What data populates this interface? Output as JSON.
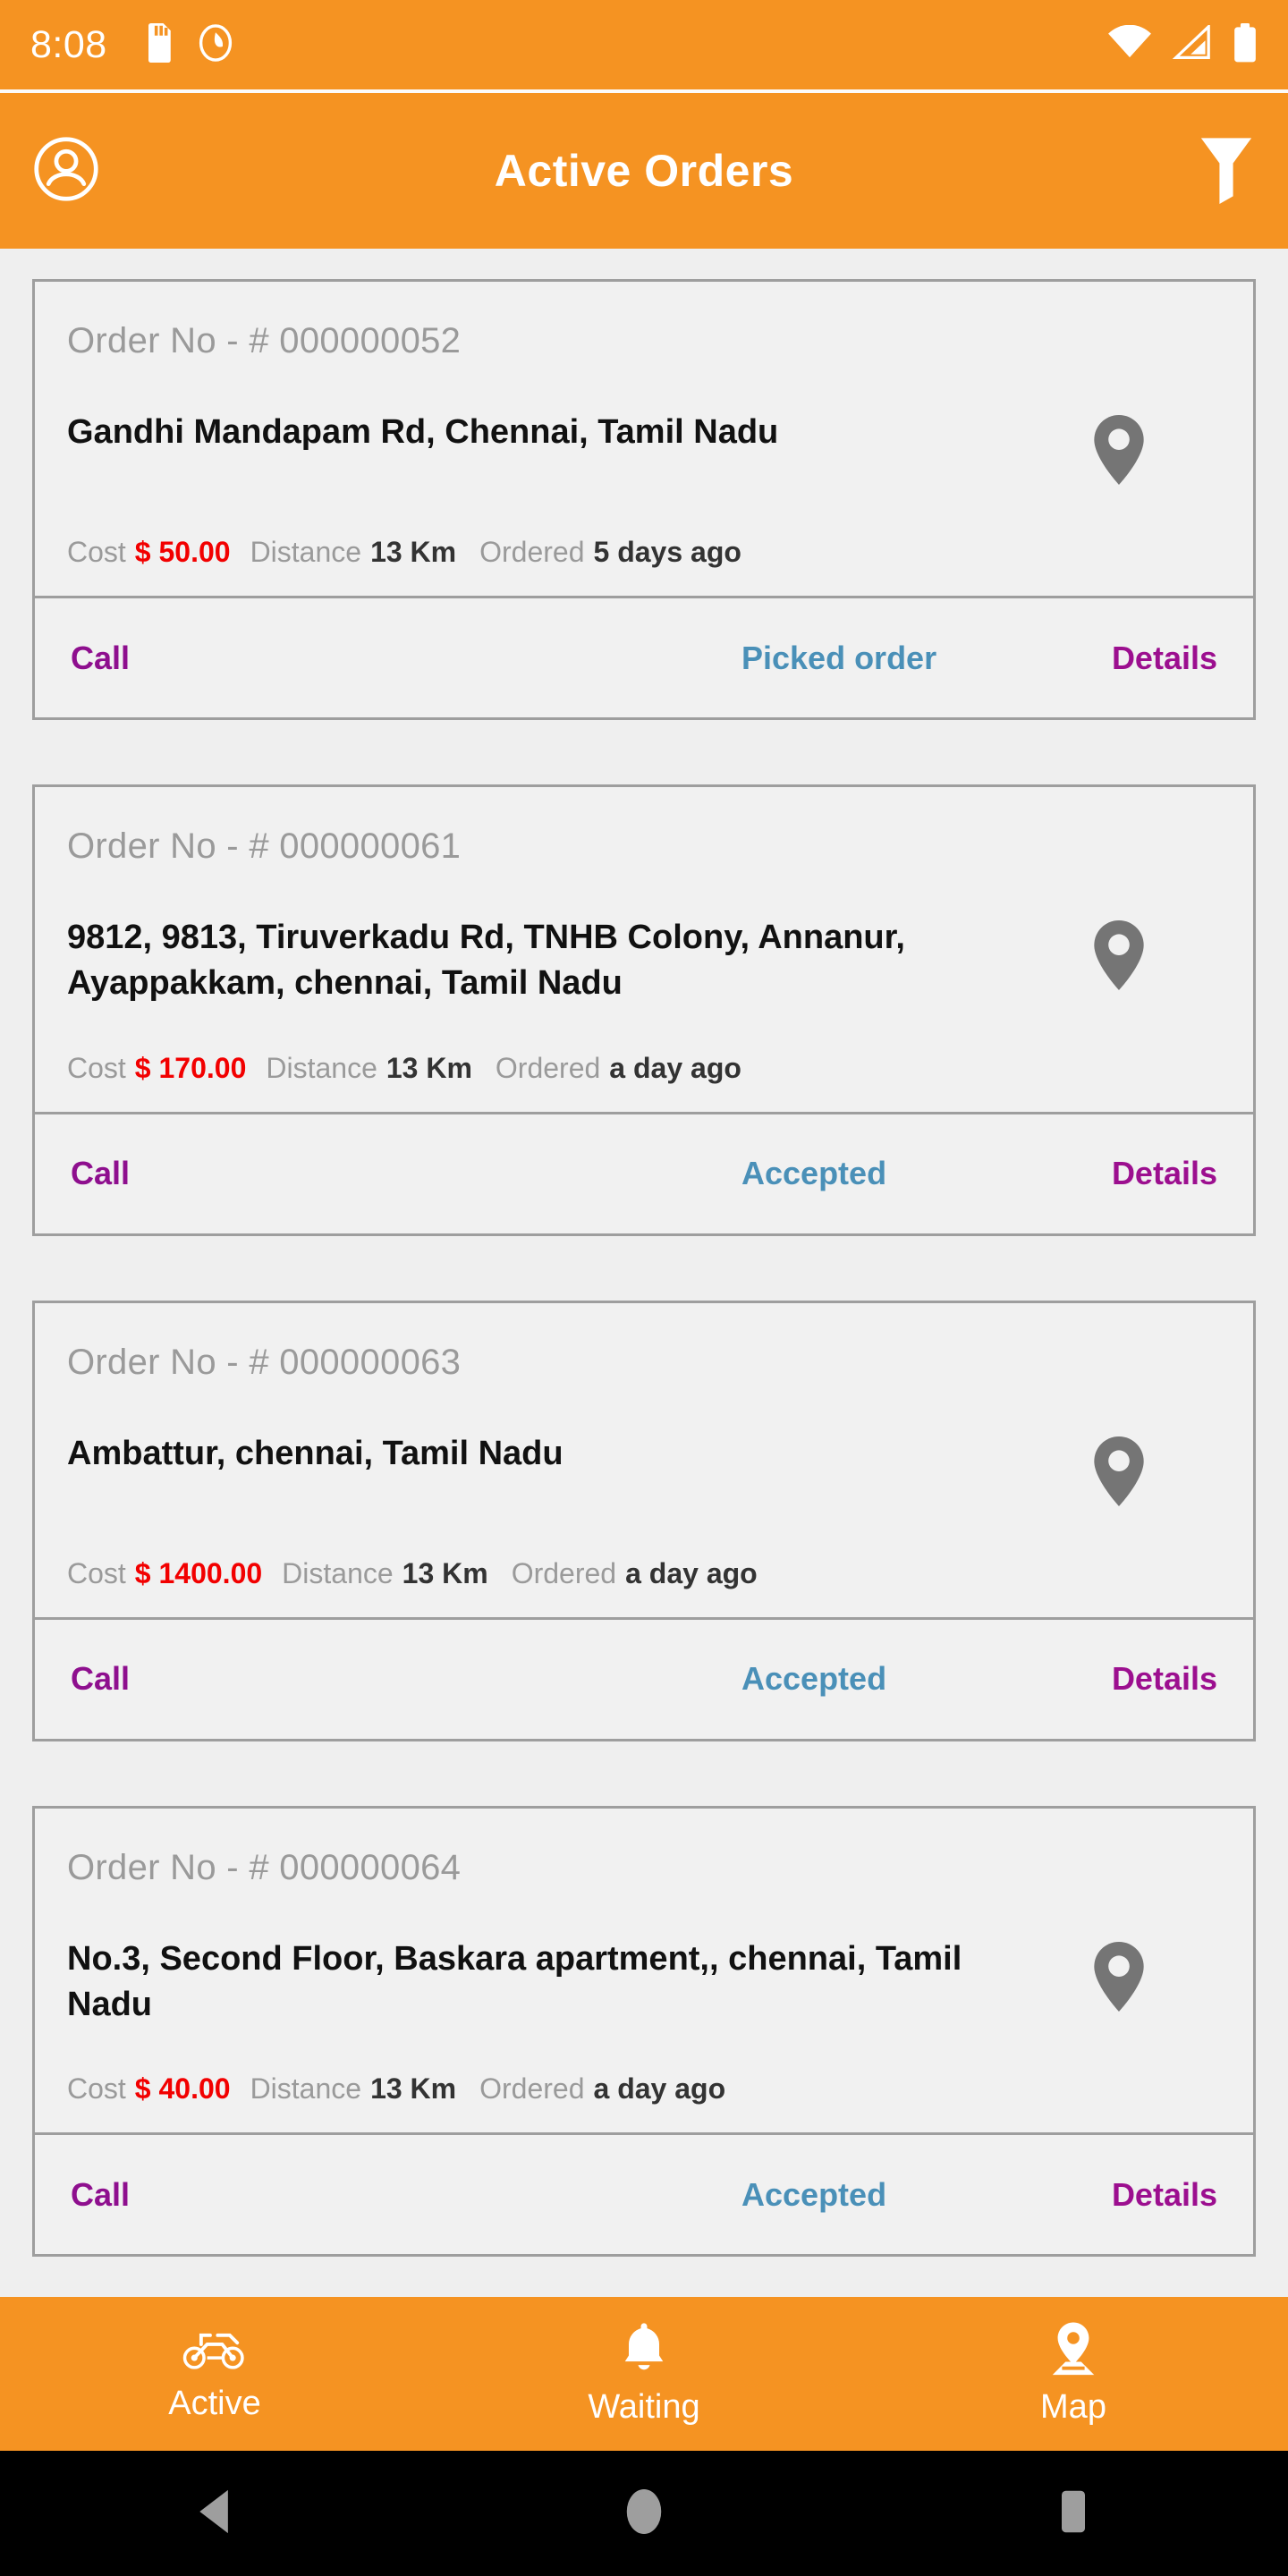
{
  "status_bar": {
    "time": "8:08",
    "icons": [
      "sd-card-icon",
      "do-not-disturb-icon",
      "wifi-icon",
      "cell-signal-icon",
      "battery-icon"
    ]
  },
  "app_bar": {
    "title": "Active Orders",
    "account_icon": "account-circle-icon",
    "filter_icon": "filter-funnel-icon",
    "background_color": "#F59322"
  },
  "labels": {
    "cost": "Cost",
    "distance": "Distance",
    "ordered": "Ordered",
    "call": "Call",
    "details": "Details"
  },
  "colors": {
    "accent_orange": "#F59322",
    "cost_red": "#f20000",
    "action_purple": "#8e0f8e",
    "action_blue": "#4a90b8",
    "order_no_gray": "#9a9a9a",
    "pin_gray": "#757575"
  },
  "orders": [
    {
      "order_no": "Order No - # 000000052",
      "address": "Gandhi Mandapam Rd, Chennai, Tamil Nadu",
      "cost": "$ 50.00",
      "distance": "13 Km",
      "ordered": "5 days ago",
      "status_action": "Picked order",
      "pin_icon": "map-pin-icon"
    },
    {
      "order_no": "Order No - # 000000061",
      "address": "9812, 9813, Tiruverkadu Rd, TNHB Colony, Annanur, Ayappakkam, chennai, Tamil Nadu",
      "cost": "$ 170.00",
      "distance": "13 Km",
      "ordered": "a day ago",
      "status_action": "Accepted",
      "pin_icon": "map-pin-icon"
    },
    {
      "order_no": "Order No - # 000000063",
      "address": "Ambattur, chennai, Tamil Nadu",
      "cost": "$ 1400.00",
      "distance": "13 Km",
      "ordered": "a day ago",
      "status_action": "Accepted",
      "pin_icon": "map-pin-icon"
    },
    {
      "order_no": "Order No - # 000000064",
      "address": "No.3, Second Floor, Baskara apartment,, chennai, Tamil Nadu",
      "cost": "$ 40.00",
      "distance": "13 Km",
      "ordered": "a day ago",
      "status_action": "Accepted",
      "pin_icon": "map-pin-icon"
    }
  ],
  "bottom_nav": {
    "items": [
      {
        "label": "Active",
        "icon": "motorcycle-icon",
        "selected": true
      },
      {
        "label": "Waiting",
        "icon": "bell-icon",
        "selected": false
      },
      {
        "label": "Map",
        "icon": "map-pin-location-icon",
        "selected": false
      }
    ]
  },
  "android_nav": {
    "back_icon": "back-triangle-icon",
    "home_icon": "home-circle-icon",
    "recents_icon": "recents-square-icon"
  }
}
